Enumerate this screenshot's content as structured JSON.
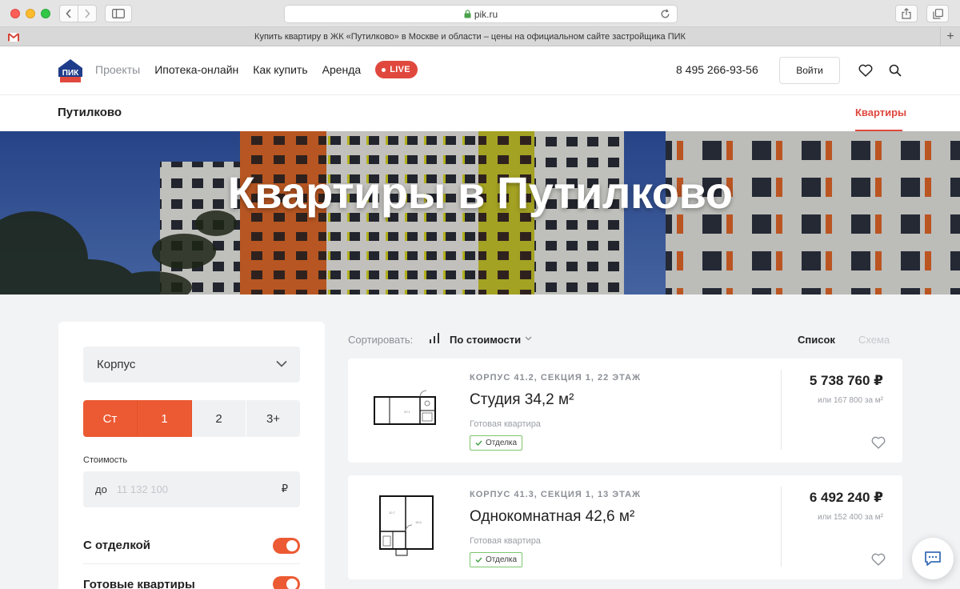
{
  "browser": {
    "url": "pik.ru",
    "tab_title": "Купить квартиру в ЖК «Путилково» в Москве и области – цены на официальном сайте застройщика ПИК",
    "new_tab_label": "+"
  },
  "header": {
    "logo_text": "ПИК",
    "nav": [
      "Проекты",
      "Ипотека-онлайн",
      "Как купить",
      "Аренда"
    ],
    "live_label": "LIVE",
    "phone": "8 495 266-93-56",
    "login_label": "Войти"
  },
  "subnav": {
    "title": "Путилково",
    "active_tab": "Квартиры"
  },
  "hero": {
    "title": "Квартиры в Путилково"
  },
  "filters": {
    "building_select": "Корпус",
    "rooms": [
      "Ст",
      "1",
      "2",
      "3+"
    ],
    "rooms_selected": [
      "Ст",
      "1"
    ],
    "price_label": "Стоимость",
    "price_prefix": "до",
    "price_placeholder": "11 132 100",
    "currency": "₽",
    "toggles": [
      {
        "label": "С отделкой",
        "on": true
      },
      {
        "label": "Готовые квартиры",
        "on": true
      }
    ]
  },
  "results": {
    "sort_label": "Сортировать:",
    "sort_value": "По стоимости",
    "view_list": "Список",
    "view_scheme": "Схема",
    "cards": [
      {
        "meta": "КОРПУС 41.2, СЕКЦИЯ 1, 22 ЭТАЖ",
        "title": "Студия 34,2 м²",
        "status": "Готовая квартира",
        "tag": "Отделка",
        "price": "5 738 760 ₽",
        "price_per_m2": "или 167 800 за м²",
        "locked": false
      },
      {
        "meta": "КОРПУС 41.3, СЕКЦИЯ 1, 13 ЭТАЖ",
        "title": "Однокомнатная 42,6 м²",
        "status": "Готовая квартира",
        "tag": "Отделка",
        "price": "6 492 240 ₽",
        "price_per_m2": "или 152 400 за м²",
        "locked": true
      }
    ]
  },
  "colors": {
    "accent": "#e0483e",
    "room_active": "#ec5a33",
    "tag_border": "#7cc56b"
  }
}
